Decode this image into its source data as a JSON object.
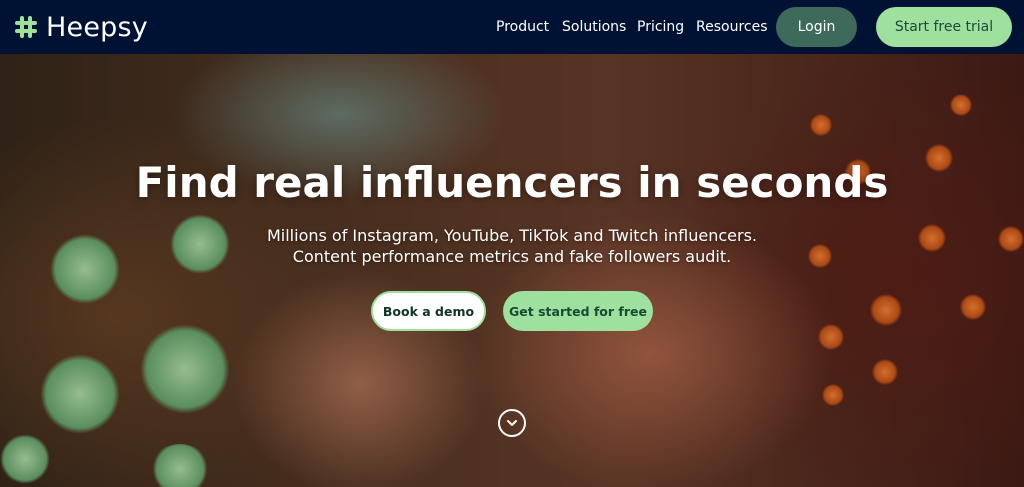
{
  "brand": {
    "name": "Heepsy",
    "accent": "#9ee09e",
    "header_bg": "#001233"
  },
  "nav": {
    "items": [
      {
        "label": "Product"
      },
      {
        "label": "Solutions"
      },
      {
        "label": "Pricing"
      },
      {
        "label": "Resources"
      }
    ],
    "login_label": "Login",
    "trial_label": "Start free trial"
  },
  "hero": {
    "title": "Find real influencers in seconds",
    "subtitle_line1": "Millions of Instagram, YouTube, TikTok and Twitch influencers.",
    "subtitle_line2": "Content performance metrics and fake followers audit.",
    "demo_label": "Book a demo",
    "start_label": "Get started for free",
    "scroll_icon": "chevron-down-icon"
  }
}
